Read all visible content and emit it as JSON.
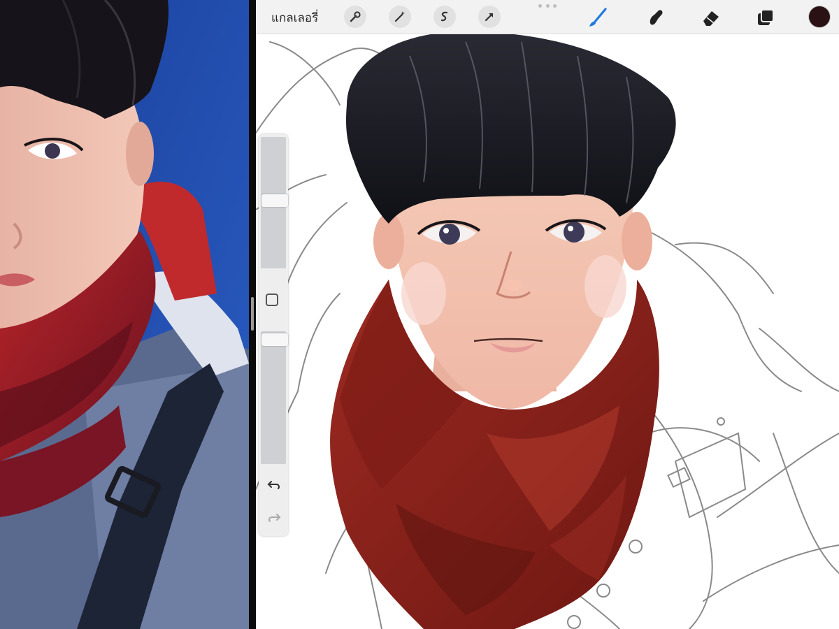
{
  "toolbar": {
    "gallery_label": "แกลเลอรี่",
    "left_tools": [
      {
        "icon": "wrench-icon",
        "name": "actions"
      },
      {
        "icon": "magic-wand-icon",
        "name": "adjustments"
      },
      {
        "icon": "selection-icon",
        "name": "selection"
      },
      {
        "icon": "arrow-cursor-icon",
        "name": "transform"
      }
    ],
    "right_tools": [
      {
        "icon": "brush-icon",
        "name": "paint",
        "active": true
      },
      {
        "icon": "smudge-icon",
        "name": "smudge",
        "active": false
      },
      {
        "icon": "eraser-icon",
        "name": "erase",
        "active": false
      },
      {
        "icon": "layers-icon",
        "name": "layers",
        "active": false
      }
    ],
    "active_tool_color": "#1f7ae0",
    "current_color": "#2a1214"
  },
  "sidebar": {
    "brush_size": 0.52,
    "brush_opacity": 0.98,
    "modify_icon": "square-icon",
    "undo_icon": "undo-icon",
    "redo_icon": "redo-icon"
  },
  "colors": {
    "scarf_red": "#8b1e1a",
    "hair_black": "#15161c",
    "reference_bg_blue": "#1f4aa8"
  }
}
